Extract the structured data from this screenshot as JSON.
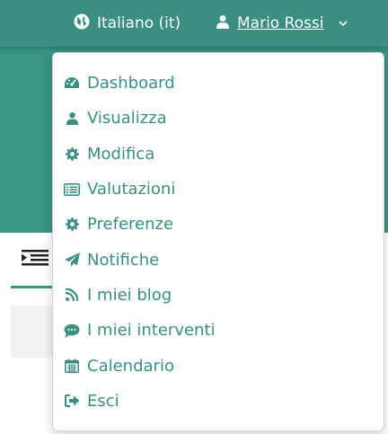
{
  "header": {
    "language_label": "Italiano (it)",
    "language_icon": "globe-icon",
    "user_name": "Mario Rossi",
    "user_icon": "user-icon",
    "dropdown_icon": "chevron-down-icon"
  },
  "colors": {
    "primary": "#3a9583",
    "header_bg": "#3a8f80",
    "link": "#3a8f80",
    "menu_bg": "#ffffff"
  },
  "user_menu": {
    "items": [
      {
        "label": "Dashboard",
        "icon": "dashboard-icon"
      },
      {
        "label": "Visualizza",
        "icon": "user-icon"
      },
      {
        "label": "Modifica",
        "icon": "gear-icon"
      },
      {
        "label": "Valutazioni",
        "icon": "list-icon"
      },
      {
        "label": "Preferenze",
        "icon": "gear-icon"
      },
      {
        "label": "Notifiche",
        "icon": "paper-plane-icon"
      },
      {
        "label": "I miei blog",
        "icon": "rss-icon"
      },
      {
        "label": "I miei interventi",
        "icon": "comment-icon"
      },
      {
        "label": "Calendario",
        "icon": "calendar-icon"
      },
      {
        "label": "Esci",
        "icon": "sign-out-icon"
      }
    ]
  },
  "background": {
    "side_icon": "indent-icon"
  }
}
